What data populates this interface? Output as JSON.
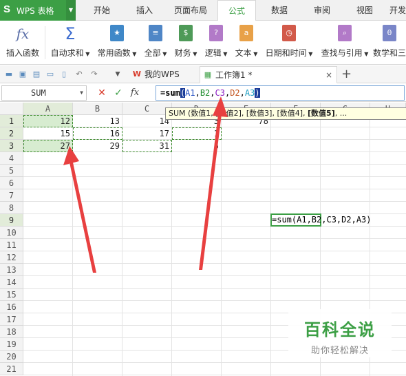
{
  "app": {
    "logo": "S",
    "name": "WPS 表格"
  },
  "menu_tabs": [
    "开始",
    "插入",
    "页面布局",
    "公式",
    "数据",
    "审阅",
    "视图",
    "开发"
  ],
  "ribbon": {
    "insert_function": "插入函数",
    "autosum": "自动求和",
    "common": "常用函数",
    "all": "全部",
    "finance": "财务",
    "logic": "逻辑",
    "text": "文本",
    "datetime": "日期和时间",
    "lookup": "查找与引用",
    "math": "数学和三"
  },
  "doc_tabs": {
    "my_wps": "我的WPS",
    "workbook": "工作簿1 *",
    "close": "×",
    "add": "+"
  },
  "formula_bar": {
    "name_box": "SUM",
    "cancel": "✕",
    "confirm": "✓",
    "fx": "fx",
    "prefix": "=sum",
    "open": "(",
    "r1": "A1",
    "c1": ",",
    "r2": "B2",
    "c2": ",",
    "r3": "C3",
    "c3": ",",
    "r4": "D2",
    "c4": ",",
    "r5": "A3",
    "close": ")"
  },
  "columns": [
    "A",
    "B",
    "C",
    "D",
    "E",
    "F",
    "G",
    "H"
  ],
  "rows": [
    "1",
    "2",
    "3",
    "4",
    "5",
    "6",
    "7",
    "8",
    "9",
    "10",
    "11",
    "12",
    "13",
    "14",
    "15",
    "16",
    "17",
    "18",
    "19",
    "20",
    "21"
  ],
  "cells": {
    "a1": "12",
    "b1": "13",
    "c1": "14",
    "d1": "3",
    "e1": "78",
    "a2": "15",
    "b2": "16",
    "c2": "17",
    "d2": "1",
    "a3": "27",
    "b3": "29",
    "c3": "31",
    "d3": "5"
  },
  "tooltip": {
    "text": "SUM (数值1, [数值2], [数值3], [数值4], ",
    "bold": "[数值5]",
    "tail": ", ..."
  },
  "edit_cell_text": "=sum(A1,B2,C3,D2,A3)",
  "watermark": {
    "title": "百科全说",
    "subtitle": "助你轻松解决"
  },
  "colors": {
    "accent": "#3c9f45",
    "arrow": "#e84040"
  }
}
